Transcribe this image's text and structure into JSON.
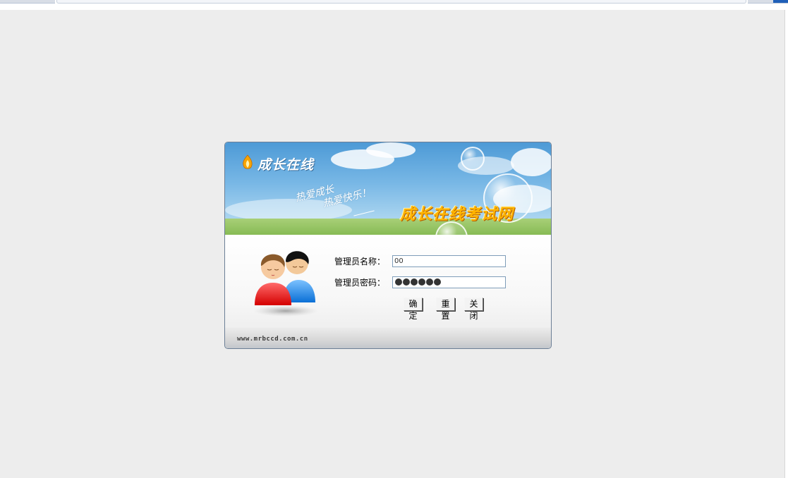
{
  "banner": {
    "brand": "成长在线",
    "slogan_line1": "热爱成长",
    "slogan_line2": "热爱快乐！",
    "site_title": "成长在线考试网"
  },
  "form": {
    "name_label": "管理员名称：",
    "name_value": "00",
    "password_label": "管理员密码：",
    "password_mask_count": 6
  },
  "buttons": {
    "ok": "确定",
    "reset": "重置",
    "close": "关闭"
  },
  "footer": {
    "url": "www.mrbccd.com.cn"
  },
  "colors": {
    "page_background": "#ededed",
    "title_orange": "#ffb400",
    "sky_blue": "#4d9ad6",
    "avatar_red": "#e81010",
    "avatar_blue": "#1f8ff0"
  },
  "icons": {
    "logo": "flame-icon",
    "avatar": "users-icon"
  }
}
